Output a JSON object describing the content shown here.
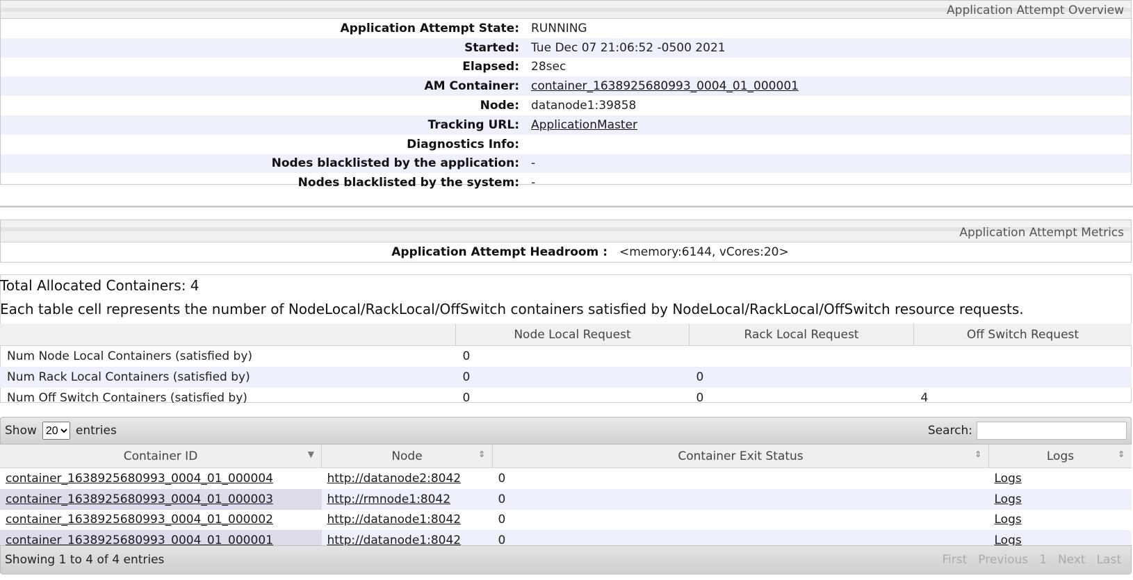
{
  "overview": {
    "title": "Application Attempt Overview",
    "rows": [
      {
        "label": "Application Attempt State:",
        "value": "RUNNING"
      },
      {
        "label": "Started:",
        "value": "Tue Dec 07 21:06:52 -0500 2021"
      },
      {
        "label": "Elapsed:",
        "value": "28sec"
      },
      {
        "label": "AM Container:",
        "value": "container_1638925680993_0004_01_000001"
      },
      {
        "label": "Node:",
        "value": "datanode1:39858"
      },
      {
        "label": "Tracking URL:",
        "value": "ApplicationMaster"
      },
      {
        "label": "Diagnostics Info:",
        "value": ""
      },
      {
        "label": "Nodes blacklisted by the application:",
        "value": "-"
      },
      {
        "label": "Nodes blacklisted by the system:",
        "value": "-"
      }
    ]
  },
  "metrics": {
    "title": "Application Attempt Metrics",
    "headroom_label": "Application Attempt Headroom :",
    "headroom_value": "<memory:6144, vCores:20>"
  },
  "allocated": {
    "total": "Total Allocated Containers: 4",
    "description": "Each table cell represents the number of NodeLocal/RackLocal/OffSwitch containers satisfied by NodeLocal/RackLocal/OffSwitch resource requests.",
    "columns": [
      "",
      "Node Local Request",
      "Rack Local Request",
      "Off Switch Request"
    ],
    "rows": [
      {
        "label": "Num Node Local Containers (satisfied by)",
        "node": "0",
        "rack": "",
        "off": ""
      },
      {
        "label": "Num Rack Local Containers (satisfied by)",
        "node": "0",
        "rack": "0",
        "off": ""
      },
      {
        "label": "Num Off Switch Containers (satisfied by)",
        "node": "0",
        "rack": "0",
        "off": "4"
      }
    ]
  },
  "containers": {
    "show_label": "Show",
    "page_size": "20",
    "entries_label": "entries",
    "search_label": "Search:",
    "search_value": "",
    "columns": [
      "Container ID",
      "Node",
      "Container Exit Status",
      "Logs"
    ],
    "rows": [
      {
        "id": "container_1638925680993_0004_01_000004",
        "node": "http://datanode2:8042",
        "status": "0",
        "logs": "Logs"
      },
      {
        "id": "container_1638925680993_0004_01_000003",
        "node": "http://rmnode1:8042",
        "status": "0",
        "logs": "Logs"
      },
      {
        "id": "container_1638925680993_0004_01_000002",
        "node": "http://datanode1:8042",
        "status": "0",
        "logs": "Logs"
      },
      {
        "id": "container_1638925680993_0004_01_000001",
        "node": "http://datanode1:8042",
        "status": "0",
        "logs": "Logs"
      }
    ],
    "info": "Showing 1 to 4 of 4 entries",
    "pager": {
      "first": "First",
      "previous": "Previous",
      "page": "1",
      "next": "Next",
      "last": "Last"
    }
  }
}
